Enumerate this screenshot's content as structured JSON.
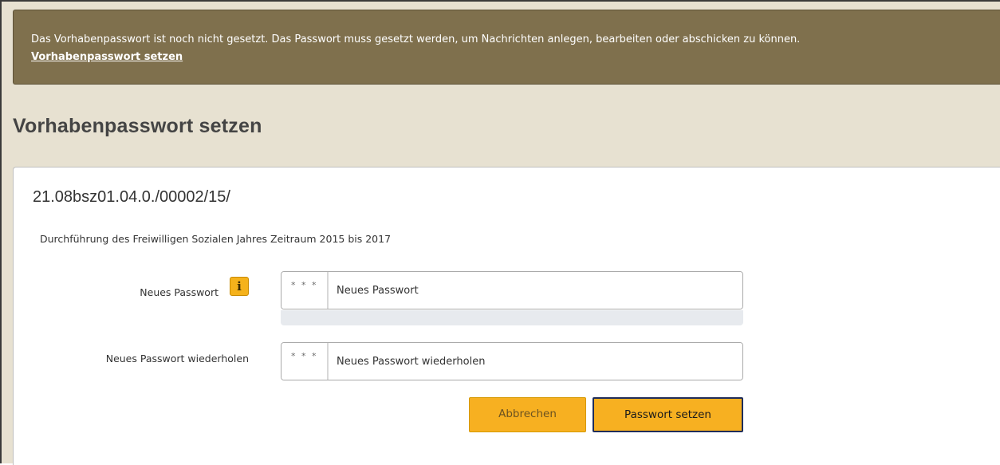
{
  "notice": {
    "message": "Das Vorhabenpasswort ist noch nicht gesetzt. Das Passwort muss gesetzt werden, um Nachrichten anlegen, bearbeiten oder abschicken zu können.",
    "link_label": "Vorhabenpasswort setzen"
  },
  "page": {
    "title": "Vorhabenpasswort setzen"
  },
  "project": {
    "id": "21.08bsz01.04.0./00002/15/",
    "description": "Durchführung des Freiwilligen Sozialen Jahres Zeitraum 2015 bis 2017"
  },
  "form": {
    "new_password": {
      "label": "Neues Passwort",
      "addon": "* * *",
      "placeholder": "Neues Passwort",
      "value": "",
      "info_icon": "info-icon"
    },
    "repeat_password": {
      "label": "Neues Passwort wiederholen",
      "addon": "* * *",
      "placeholder": "Neues Passwort wiederholen",
      "value": ""
    },
    "buttons": {
      "cancel": "Abbrechen",
      "submit": "Passwort setzen"
    }
  },
  "colors": {
    "notice_bg": "#7f704d",
    "header_bg": "#e7e1d1",
    "button_bg": "#f7b021",
    "submit_border": "#1f2d5a"
  }
}
